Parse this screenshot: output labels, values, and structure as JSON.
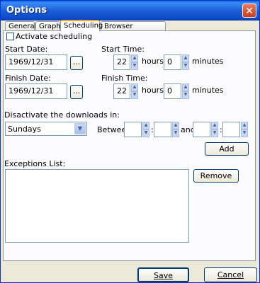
{
  "window": {
    "title": "Options",
    "close_glyph": "✕"
  },
  "tabs": [
    {
      "label": "General"
    },
    {
      "label": "Graph"
    },
    {
      "label": "Scheduling",
      "active": true
    },
    {
      "label": "Browser Integration"
    }
  ],
  "scheduling": {
    "activate_label": "Activate scheduling",
    "start_date_label": "Start Date:",
    "start_date_value": "1969/12/31",
    "start_time_label": "Start Time:",
    "start_hours": "22",
    "start_minutes": "0",
    "finish_date_label": "Finish Date:",
    "finish_date_value": "1969/12/31",
    "finish_time_label": "Finish Time:",
    "finish_hours": "22",
    "finish_minutes": "0",
    "hours_label": "hours",
    "minutes_label": "minutes",
    "browse_label": "...",
    "deactivate_label": "Disactivate the downloads in:",
    "day_selected": "Sundays",
    "between_label": "Between",
    "colon": ":",
    "and_label": "and",
    "add_label": "Add",
    "exceptions_label": "Exceptions List:",
    "remove_label": "Remove"
  },
  "footer": {
    "save_label": "Save",
    "cancel_label": "Cancel"
  }
}
